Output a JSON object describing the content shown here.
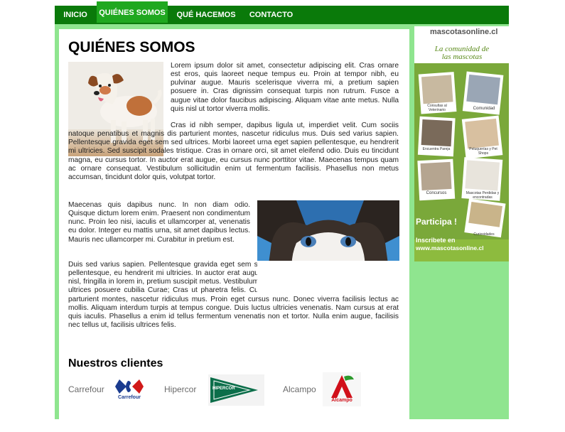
{
  "nav": {
    "items": [
      {
        "label": "INICIO",
        "active": false
      },
      {
        "label": "QUIÉNES SOMOS",
        "active": true
      },
      {
        "label": "QUÉ HACEMOS",
        "active": false
      },
      {
        "label": "CONTACTO",
        "active": false
      }
    ]
  },
  "page": {
    "title": "QUIÉNES SOMOS",
    "paragraphs": [
      "Lorem ipsum dolor sit amet, consectetur adipiscing elit. Cras ornare est eros, quis laoreet neque tempus eu. Proin at tempor nibh, eu pulvinar augue. Mauris scelerisque viverra mi, a pretium sapien posuere in. Cras dignissim consequat turpis non rutrum. Fusce a augue vitae dolor faucibus adipiscing. Aliquam vitae ante metus. Nulla quis nisl ut tortor viverra mollis.",
      "Cras id nibh semper, dapibus ligula ut, imperdiet velit. Cum sociis natoque penatibus et magnis dis parturient montes, nascetur ridiculus mus. Duis sed varius sapien. Pellentesque gravida eget sem sed ultrices. Morbi laoreet urna eget sapien pellentesque, eu hendrerit mi ultricies. Sed suscipit sodales tristique. Cras in ornare orci, sit amet eleifend odio. Duis eu tincidunt magna, eu cursus tortor. In auctor erat augue, eu cursus nunc porttitor vitae. Maecenas tempus quam ac ornare consequat. Vestibulum sollicitudin enim ut fermentum facilisis. Phasellus non metus accumsan, tincidunt dolor quis, volutpat tortor.",
      "Maecenas quis dapibus nunc. In non diam odio. Quisque dictum lorem enim. Praesent non condimentum nunc. Proin leo nisi, iaculis et ullamcorper at, venenatis eu dolor. Integer eu mattis urna, sit amet dapibus lectus. Mauris nec ullamcorper mi. Curabitur in pretium est.",
      "Duis sed varius sapien. Pellentesque gravida eget sem sed ultrices. Morbi laoreet urna eget sapien pellentesque, eu hendrerit mi ultricies. In auctor erat augue, eu cursus nunc porttitor vitae. Cras velit nisl, fringilla in lorem in, pretium suscipit metus. Vestibulum ante ipsum primis in faucibus orci luctus et ultrices posuere cubilia Curae; Cras ut pharetra felis. Cum sociis natoque penatibus et magnis dis parturient montes, nascetur ridiculus mus. Proin eget cursus nunc. Donec viverra facilisis lectus ac mollis. Aliquam interdum turpis at tempus congue. Duis luctus ultricies venenatis. Nam cursus at erat quis iaculis. Phasellus a enim id tellus fermentum venenatis non et tortor. Nulla enim augue, facilisis nec tellus ut, facilisis ultrices felis."
    ]
  },
  "clients": {
    "title": "Nuestros clientes",
    "items": [
      {
        "name": "Carrefour",
        "logo_text": "Carrefour"
      },
      {
        "name": "Hipercor",
        "logo_text": "HIPERCOR"
      },
      {
        "name": "Alcampo",
        "logo_text": "Alcampo"
      }
    ]
  },
  "ad": {
    "brand": "mascotasonline.cl",
    "tagline_1": "La comunidad de",
    "tagline_2": "las mascotas",
    "cards": [
      "Consultas al Veterinario",
      "Comunidad",
      "Encuentra Pareja",
      "Peluquerías y Pet Shops",
      "Concursos",
      "Mascotas Perdidas y encontradas",
      "Curiosidades"
    ],
    "cta": "Participa !",
    "signup": "Inscribete en",
    "url": "www.mascotasonline.cl"
  },
  "colors": {
    "nav_bg": "#0a7a0a",
    "nav_active": "#1fa81f",
    "frame": "#8fe58f",
    "ad_green": "#7aa83a"
  }
}
